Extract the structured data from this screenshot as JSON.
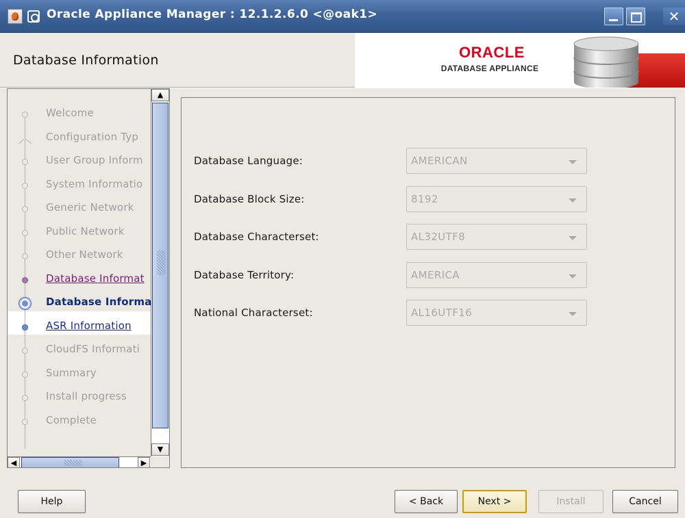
{
  "window": {
    "title": "Oracle Appliance Manager : 12.1.2.6.0 <@oak1>",
    "close_glyph": "✕"
  },
  "header": {
    "page_title": "Database Information",
    "logo_oracle": "ORACLE",
    "logo_subtitle": "DATABASE APPLIANCE"
  },
  "nav": {
    "steps": [
      {
        "label": "Welcome",
        "state": "pending"
      },
      {
        "label": "Configuration Typ",
        "state": "pending"
      },
      {
        "label": "User Group Inform",
        "state": "pending"
      },
      {
        "label": "System Informatio",
        "state": "pending"
      },
      {
        "label": "Generic Network",
        "state": "pending"
      },
      {
        "label": "Public Network",
        "state": "pending"
      },
      {
        "label": "Other Network",
        "state": "pending"
      },
      {
        "label": "Database Informat",
        "state": "visited"
      },
      {
        "label": "Database Informa",
        "state": "current"
      },
      {
        "label": "ASR Information",
        "state": "link"
      },
      {
        "label": "CloudFS Informati",
        "state": "pending"
      },
      {
        "label": "Summary",
        "state": "pending"
      },
      {
        "label": "Install progress",
        "state": "pending"
      },
      {
        "label": "Complete",
        "state": "pending"
      }
    ]
  },
  "form": {
    "fields": [
      {
        "label": "Database Language:",
        "value": "AMERICAN"
      },
      {
        "label": "Database Block Size:",
        "value": "8192"
      },
      {
        "label": "Database Characterset:",
        "value": "AL32UTF8"
      },
      {
        "label": "Database Territory:",
        "value": "AMERICA"
      },
      {
        "label": "National Characterset:",
        "value": "AL16UTF16"
      }
    ]
  },
  "buttons": {
    "help": "Help",
    "back": "< Back",
    "next": "Next >",
    "install": "Install",
    "cancel": "Cancel"
  },
  "colors": {
    "titlebar": "#3d6399",
    "oracle_red": "#e3001b",
    "visited_link": "#7a1e74",
    "link": "#1a2b9c",
    "current_step": "#0f2d7a",
    "default_button_border": "#d39a00"
  }
}
